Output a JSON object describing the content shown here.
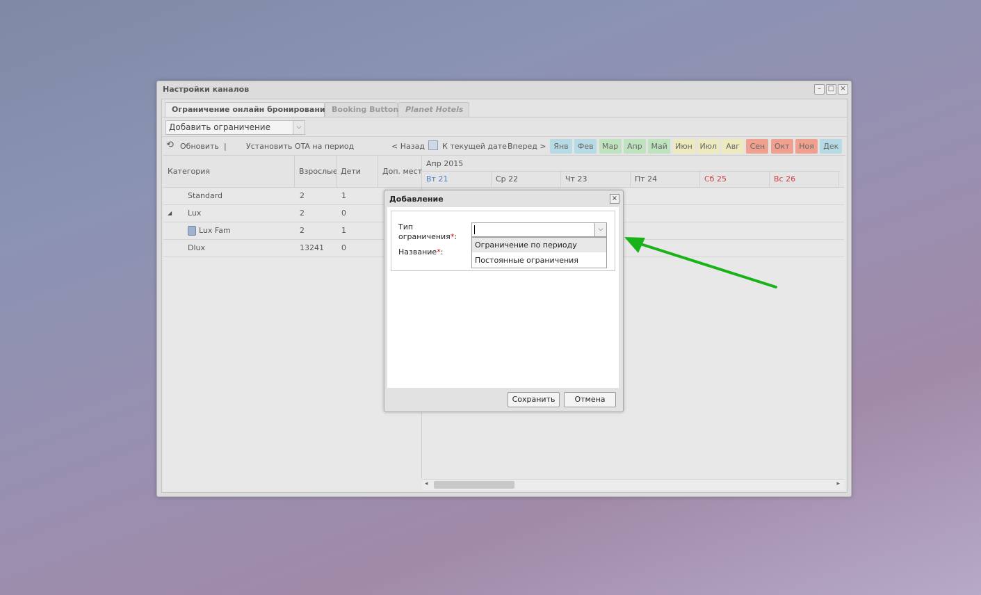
{
  "window": {
    "title": "Настройки каналов",
    "controls": [
      "–",
      "□",
      "×"
    ]
  },
  "tabs": [
    {
      "label": "Ограничение онлайн бронирований",
      "active": true
    },
    {
      "label": "Booking Button",
      "active": false
    },
    {
      "label": "Planet Hotels",
      "active": false
    }
  ],
  "combo": {
    "value": "Добавить ограничение",
    "trigger_icon": "chevron-down-icon"
  },
  "toolbar": {
    "refresh": "Обновить",
    "separator": "|",
    "set_ota": "Установить OTA на период",
    "back": "< Назад",
    "today": "К текущей дате",
    "forward": "Вперед >"
  },
  "months": [
    {
      "label": "Янв",
      "color": "#b7dbe4"
    },
    {
      "label": "Фев",
      "color": "#b7dbe4"
    },
    {
      "label": "Мар",
      "color": "#bfe3bf"
    },
    {
      "label": "Апр",
      "color": "#bfe3bf"
    },
    {
      "label": "Май",
      "color": "#bfe3bf"
    },
    {
      "label": "Июн",
      "color": "#eeeac0"
    },
    {
      "label": "Июл",
      "color": "#eeeac0"
    },
    {
      "label": "Авг",
      "color": "#eeeac0"
    },
    {
      "label": "Сен",
      "color": "#f0a08e"
    },
    {
      "label": "Окт",
      "color": "#f0a08e"
    },
    {
      "label": "Ноя",
      "color": "#f0a08e"
    },
    {
      "label": "Дек",
      "color": "#b7dbe4"
    }
  ],
  "grid": {
    "headers": {
      "category": "Категория",
      "adults": "Взрослые",
      "children": "Дети",
      "extra": "Доп. мест"
    },
    "period": "Апр 2015",
    "days": [
      {
        "label": "Вт 21",
        "color": "#4a7fc0"
      },
      {
        "label": "Ср 22",
        "color": "#555555"
      },
      {
        "label": "Чт 23",
        "color": "#555555"
      },
      {
        "label": "Пт 24",
        "color": "#555555"
      },
      {
        "label": "Сб 25",
        "color": "#d04040"
      },
      {
        "label": "Вс 26",
        "color": "#d04040"
      }
    ],
    "rows": [
      {
        "name": "Standard",
        "adults": "2",
        "children": "1"
      },
      {
        "name": "Lux",
        "adults": "2",
        "children": "0",
        "expander": "◢"
      },
      {
        "name": "Lux Fam",
        "adults": "2",
        "children": "1",
        "icon": "room-icon"
      },
      {
        "name": "Dlux",
        "adults": "13241",
        "children": "0"
      }
    ]
  },
  "dialog": {
    "title": "Добавление",
    "close": "×",
    "type_label_1": "Тип",
    "type_label_2": "ограничения",
    "name_label": "Название",
    "required_mark": "*",
    "colon": ":",
    "type_value": "",
    "options": [
      "Ограничение по периоду",
      "Постоянные ограничения"
    ],
    "save": "Сохранить",
    "cancel": "Отмена"
  },
  "annotation": {
    "arrow_color": "#19b319"
  }
}
